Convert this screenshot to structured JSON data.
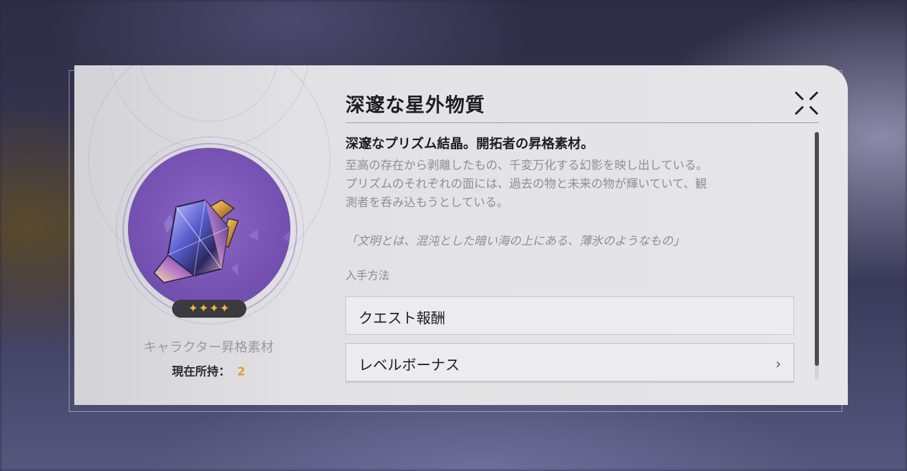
{
  "item": {
    "name": "深邃な星外物質",
    "rarity_stars": "✦✦✦✦",
    "type": "キャラクター昇格素材",
    "owned_label": "現在所持：",
    "owned_count": "2",
    "subtitle": "深邃なプリズム結晶。開拓者の昇格素材。",
    "description_lines": [
      "至高の存在から剥離したもの、千変万化する幻影を映し出している。",
      "プリズムのそれぞれの面には、過去の物と未来の物が輝いていて、観",
      "測者を呑み込もうとしている。"
    ],
    "quote": "「文明とは、混沌とした暗い海の上にある、薄氷のようなもの」",
    "obtain_heading": "入手方法",
    "sources": [
      {
        "label": "クエスト報酬"
      },
      {
        "label": "レベルボーナス"
      }
    ]
  },
  "icons": {
    "close": "close-x-icon",
    "chevron": "chevron-right-icon",
    "item": "prism-crystal-icon"
  },
  "colors": {
    "accent_gold": "#e0a030",
    "icon_bg_purple": "#7552b1",
    "panel_bg": "#e4e4e7"
  }
}
